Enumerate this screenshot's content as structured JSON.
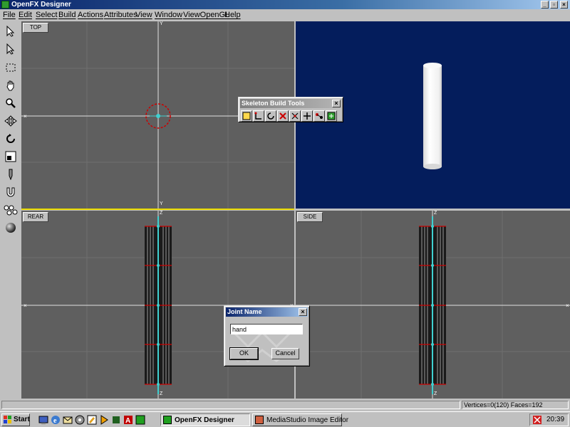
{
  "app": {
    "title": "OpenFX Designer"
  },
  "menu": [
    "File",
    "Edit",
    "Select",
    "Build",
    "Actions",
    "Attributes",
    "View",
    "Window",
    "ViewOpenGL",
    "Help"
  ],
  "toolbar": {
    "hotkeys": [
      "O",
      "V",
      "G",
      "",
      "Z",
      "M",
      "R",
      "S",
      "D",
      "",
      "",
      ""
    ]
  },
  "viewports": {
    "top": {
      "label": "TOP",
      "axis_top": "Y",
      "axis_bottom": "Y"
    },
    "rear": {
      "label": "REAR",
      "axis_top": "Z",
      "axis_bottom": "Z"
    },
    "side": {
      "label": "SIDE",
      "axis_top": "Z",
      "axis_bottom": "Z"
    }
  },
  "skeleton_tools": {
    "title": "Skeleton Build Tools",
    "icons": [
      "new-joint-icon",
      "joint-angle-icon",
      "rotate-joint-icon",
      "delete-joint-icon",
      "pick-joint-icon",
      "move-joint-icon",
      "link-joints-icon",
      "assign-vertices-icon"
    ]
  },
  "joint_dialog": {
    "title": "Joint Name",
    "value": "hand",
    "ok_label": "OK",
    "cancel_label": "Cancel"
  },
  "status": {
    "counts": "Vertices=0(120) Faces=192"
  },
  "taskbar": {
    "start_label": "Start",
    "tasks": [
      {
        "label": "OpenFX Designer",
        "active": true
      },
      {
        "label": "MediaStudio Image Editor",
        "active": false
      }
    ],
    "clock": "20:39"
  },
  "colors": {
    "viewport_grey": "#5f5f5f",
    "viewport_blue": "#041d5c",
    "cursor_red": "#cc0000",
    "axis_cyan": "#3fd0d0"
  }
}
